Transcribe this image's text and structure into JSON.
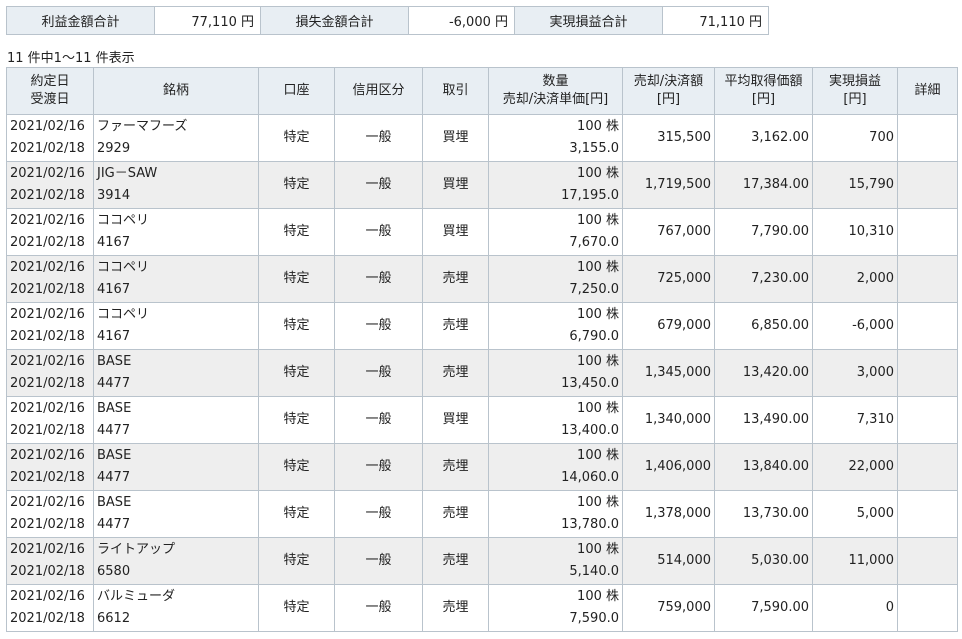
{
  "summary": {
    "profit_label": "利益金額合計",
    "profit_value": "77,110 円",
    "loss_label": "損失金額合計",
    "loss_value": "-6,000 円",
    "realized_label": "実現損益合計",
    "realized_value": "71,110 円"
  },
  "count_text": "11 件中1～11 件表示",
  "headers": {
    "date1": "約定日",
    "date2": "受渡日",
    "symbol": "銘柄",
    "account": "口座",
    "credit": "信用区分",
    "trade": "取引",
    "qty1": "数量",
    "qty2": "売却/決済単価[円]",
    "sale1": "売却/決済額",
    "sale2": "[円]",
    "avg1": "平均取得価額",
    "avg2": "[円]",
    "pl1": "実現損益",
    "pl2": "[円]",
    "detail": "詳細"
  },
  "rows": [
    {
      "trade_date": "2021/02/16",
      "settle_date": "2021/02/18",
      "name": "ファーマフーズ",
      "code": "2929",
      "account": "特定",
      "credit": "一般",
      "trade": "買埋",
      "qty": "100 株",
      "unit_price": "3,155.0",
      "sale": "315,500",
      "avg": "3,162.00",
      "pl": "700"
    },
    {
      "trade_date": "2021/02/16",
      "settle_date": "2021/02/18",
      "name": "JIG－SAW",
      "code": "3914",
      "account": "特定",
      "credit": "一般",
      "trade": "買埋",
      "qty": "100 株",
      "unit_price": "17,195.0",
      "sale": "1,719,500",
      "avg": "17,384.00",
      "pl": "15,790"
    },
    {
      "trade_date": "2021/02/16",
      "settle_date": "2021/02/18",
      "name": "ココペリ",
      "code": "4167",
      "account": "特定",
      "credit": "一般",
      "trade": "買埋",
      "qty": "100 株",
      "unit_price": "7,670.0",
      "sale": "767,000",
      "avg": "7,790.00",
      "pl": "10,310"
    },
    {
      "trade_date": "2021/02/16",
      "settle_date": "2021/02/18",
      "name": "ココペリ",
      "code": "4167",
      "account": "特定",
      "credit": "一般",
      "trade": "売埋",
      "qty": "100 株",
      "unit_price": "7,250.0",
      "sale": "725,000",
      "avg": "7,230.00",
      "pl": "2,000"
    },
    {
      "trade_date": "2021/02/16",
      "settle_date": "2021/02/18",
      "name": "ココペリ",
      "code": "4167",
      "account": "特定",
      "credit": "一般",
      "trade": "売埋",
      "qty": "100 株",
      "unit_price": "6,790.0",
      "sale": "679,000",
      "avg": "6,850.00",
      "pl": "-6,000"
    },
    {
      "trade_date": "2021/02/16",
      "settle_date": "2021/02/18",
      "name": "BASE",
      "code": "4477",
      "account": "特定",
      "credit": "一般",
      "trade": "売埋",
      "qty": "100 株",
      "unit_price": "13,450.0",
      "sale": "1,345,000",
      "avg": "13,420.00",
      "pl": "3,000"
    },
    {
      "trade_date": "2021/02/16",
      "settle_date": "2021/02/18",
      "name": "BASE",
      "code": "4477",
      "account": "特定",
      "credit": "一般",
      "trade": "買埋",
      "qty": "100 株",
      "unit_price": "13,400.0",
      "sale": "1,340,000",
      "avg": "13,490.00",
      "pl": "7,310"
    },
    {
      "trade_date": "2021/02/16",
      "settle_date": "2021/02/18",
      "name": "BASE",
      "code": "4477",
      "account": "特定",
      "credit": "一般",
      "trade": "売埋",
      "qty": "100 株",
      "unit_price": "14,060.0",
      "sale": "1,406,000",
      "avg": "13,840.00",
      "pl": "22,000"
    },
    {
      "trade_date": "2021/02/16",
      "settle_date": "2021/02/18",
      "name": "BASE",
      "code": "4477",
      "account": "特定",
      "credit": "一般",
      "trade": "売埋",
      "qty": "100 株",
      "unit_price": "13,780.0",
      "sale": "1,378,000",
      "avg": "13,730.00",
      "pl": "5,000"
    },
    {
      "trade_date": "2021/02/16",
      "settle_date": "2021/02/18",
      "name": "ライトアップ",
      "code": "6580",
      "account": "特定",
      "credit": "一般",
      "trade": "売埋",
      "qty": "100 株",
      "unit_price": "5,140.0",
      "sale": "514,000",
      "avg": "5,030.00",
      "pl": "11,000"
    },
    {
      "trade_date": "2021/02/16",
      "settle_date": "2021/02/18",
      "name": "バルミューダ",
      "code": "6612",
      "account": "特定",
      "credit": "一般",
      "trade": "売埋",
      "qty": "100 株",
      "unit_price": "7,590.0",
      "sale": "759,000",
      "avg": "7,590.00",
      "pl": "0"
    }
  ]
}
